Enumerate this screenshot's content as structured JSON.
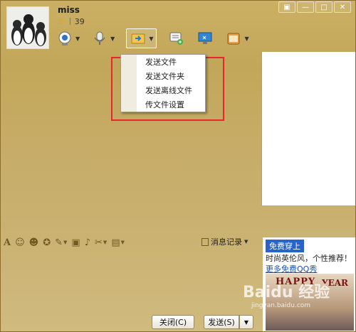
{
  "header": {
    "username": "miss",
    "level": "39",
    "level_icon": "star-icon"
  },
  "window_controls": [
    {
      "name": "menu-icon",
      "glyph": "▣"
    },
    {
      "name": "minimize-icon",
      "glyph": "—"
    },
    {
      "name": "maximize-icon",
      "glyph": "□"
    },
    {
      "name": "close-icon",
      "glyph": "✕"
    }
  ],
  "toolbar": {
    "items": [
      {
        "name": "video-call-icon",
        "has_dropdown": true
      },
      {
        "name": "voice-call-icon",
        "has_dropdown": true
      },
      {
        "name": "send-file-icon",
        "has_dropdown": true,
        "active": true
      },
      {
        "name": "multichat-icon",
        "has_dropdown": false
      },
      {
        "name": "remote-desktop-icon",
        "has_dropdown": false
      },
      {
        "name": "app-icon",
        "has_dropdown": true
      }
    ]
  },
  "file_menu": {
    "items": [
      "发送文件",
      "发送文件夹",
      "发送离线文件",
      "传文件设置"
    ]
  },
  "input_toolbar": {
    "icons": [
      "font-icon",
      "emoji-icon",
      "face-icon",
      "magic-icon",
      "edit-icon",
      "image-icon",
      "music-icon",
      "screenshot-icon",
      "schedule-icon"
    ],
    "message_log_label": "消息记录"
  },
  "footer": {
    "close_label": "关闭(C)",
    "send_label": "发送(S)"
  },
  "ad": {
    "tag": "免费穿上",
    "line1": "时尚英伦风，个性推荐！",
    "line2": "更多免费QQ秀",
    "pic_text_left": "HAPPY",
    "pic_text_right": "YEAR"
  },
  "watermark": {
    "text": "Baidu 经验",
    "sub": "jingyan.baidu.com"
  },
  "colors": {
    "window_bg": "#c2a75a",
    "highlight_border": "#e8262c",
    "link": "#1a4fb5",
    "ad_tag_bg": "#2a63c8"
  }
}
